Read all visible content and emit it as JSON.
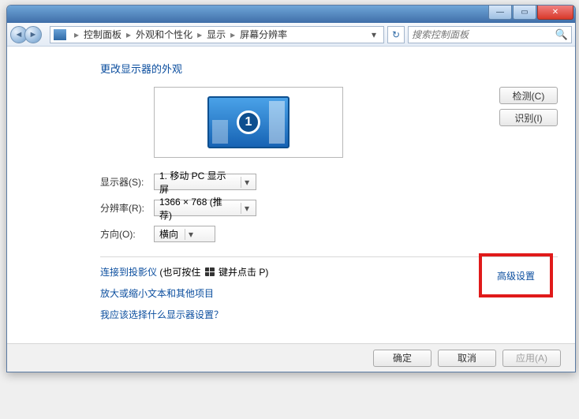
{
  "titlebar": {
    "min": "—",
    "max": "▭",
    "close": "✕"
  },
  "breadcrumb": {
    "items": [
      "控制面板",
      "外观和个性化",
      "显示",
      "屏幕分辨率"
    ]
  },
  "search": {
    "placeholder": "搜索控制面板"
  },
  "page": {
    "heading": "更改显示器的外观",
    "detect": "检测(C)",
    "identify": "识别(I)",
    "display_label": "显示器(S):",
    "display_value": "1. 移动 PC 显示屏",
    "resolution_label": "分辨率(R):",
    "resolution_value": "1366 × 768 (推荐)",
    "orientation_label": "方向(O):",
    "orientation_value": "横向",
    "advanced": "高级设置",
    "projector_prefix": "连接到投影仪",
    "projector_hint_a": " (也可按住 ",
    "projector_hint_b": " 键并点击 P)",
    "text_size_link": "放大或缩小文本和其他项目",
    "which_display_link": "我应该选择什么显示器设置？",
    "monitor_number": "1"
  },
  "footer": {
    "ok": "确定",
    "cancel": "取消",
    "apply": "应用(A)"
  }
}
